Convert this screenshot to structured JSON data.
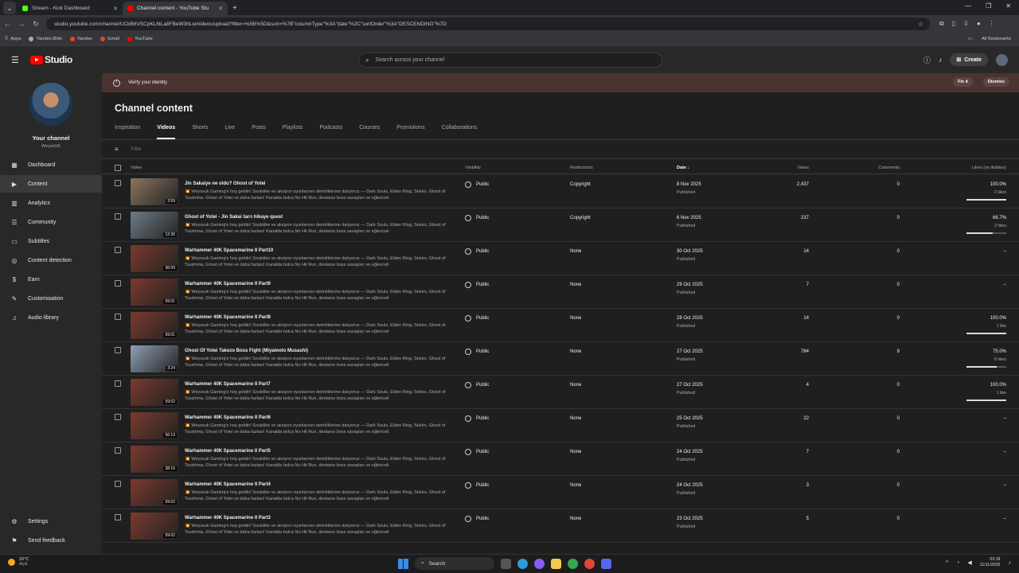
{
  "browser": {
    "tabs": [
      {
        "title": "Stream - Kick Dashboard",
        "fav_color": "#53fc18"
      },
      {
        "title": "Channel content - YouTube Stu",
        "fav_color": "#ff0000"
      }
    ],
    "url": "studio.youtube.com/channel/UCkB6VSCpKL6tLa8FBeW3hLw/videos/upload?filter=%5B%5D&sort=%7B\"columnType\"%3A\"date\"%2C\"sortOrder\"%3A\"DESCENDING\"%7D",
    "bookmarks": [
      "Apps",
      "Yandex.Bilet",
      "Yandex",
      "Gmail",
      "YouTube"
    ],
    "all_bookmarks": "All Bookmarks"
  },
  "header": {
    "logo_text": "Studio",
    "search_placeholder": "Search across your channel",
    "create_label": "Create"
  },
  "sidebar": {
    "channel_title": "Your channel",
    "channel_handle": "WeyssUK",
    "items": [
      {
        "label": "Dashboard",
        "icon": "dashboard-icon",
        "glyph": "▦"
      },
      {
        "label": "Content",
        "icon": "content-icon",
        "glyph": "▶"
      },
      {
        "label": "Analytics",
        "icon": "analytics-icon",
        "glyph": "▥"
      },
      {
        "label": "Community",
        "icon": "community-icon",
        "glyph": "☰"
      },
      {
        "label": "Subtitles",
        "icon": "subtitles-icon",
        "glyph": "▭"
      },
      {
        "label": "Content detection",
        "icon": "content-detection-icon",
        "glyph": "◎"
      },
      {
        "label": "Earn",
        "icon": "earn-icon",
        "glyph": "$"
      },
      {
        "label": "Customisation",
        "icon": "customisation-icon",
        "glyph": "✎"
      },
      {
        "label": "Audio library",
        "icon": "audio-library-icon",
        "glyph": "♫"
      }
    ],
    "settings": "Settings",
    "feedback": "Send feedback"
  },
  "banner": {
    "text": "Verify your identity",
    "fix": "Fix it",
    "dismiss": "Dismiss"
  },
  "page": {
    "title": "Channel content",
    "tabs": [
      "Inspiration",
      "Videos",
      "Shorts",
      "Live",
      "Posts",
      "Playlists",
      "Podcasts",
      "Courses",
      "Promotions",
      "Collaborations"
    ],
    "active_tab": "Videos",
    "filter_placeholder": "Filter"
  },
  "table": {
    "columns": {
      "video": "Video",
      "visibility": "Visibility",
      "restrictions": "Restrictions",
      "date": "Date ↓",
      "views": "Views",
      "comments": "Comments",
      "likes": "Likes (vs dislikes)"
    },
    "description": "💥 Weyssuk Gaming'e hoş geldin! Soulslike ve aksiyon oyunlarının derinliklerine dalıyoruz — Dark Souls, Elden Ring, Sekiro, Ghost of Tsushima, Ghost of Yotei ve daha fazlası! Kanalda bolca No Hit Run, destansı boss savaşları ve eğlenceli",
    "rows": [
      {
        "title": "Jin Sakaiye ne oldu? Ghost of Yotei",
        "duration": "2:59",
        "visibility": "Public",
        "restrictions": "Copyright",
        "date": "8 Nov 2025",
        "status": "Published",
        "views": "2,437",
        "comments": "0",
        "likes": "100.0%",
        "likes_count": "2 likes",
        "like_ratio": 1.0,
        "thumb": "#8a7560"
      },
      {
        "title": "Ghost of Yotei - Jin Sakai tarrı hikaye quest",
        "duration": "12:36",
        "visibility": "Public",
        "restrictions": "Copyright",
        "date": "6 Nov 2025",
        "status": "Published",
        "views": "237",
        "comments": "0",
        "likes": "66.7%",
        "likes_count": "2 likes",
        "like_ratio": 0.667,
        "thumb": "#6f7c86"
      },
      {
        "title": "Warhammer 40K Spacemarine II Part10",
        "duration": "36:09",
        "visibility": "Public",
        "restrictions": "None",
        "date": "30 Oct 2025",
        "status": "Published",
        "views": "14",
        "comments": "0",
        "likes": "–",
        "likes_count": "",
        "like_ratio": null,
        "thumb": "#7a3a2e"
      },
      {
        "title": "Warhammer 40K Spacemarine II Part9",
        "duration": "59:01",
        "visibility": "Public",
        "restrictions": "None",
        "date": "29 Oct 2025",
        "status": "Published",
        "views": "7",
        "comments": "0",
        "likes": "–",
        "likes_count": "",
        "like_ratio": null,
        "thumb": "#7a3a2e"
      },
      {
        "title": "Warhammer 40K Spacemarine II Part8",
        "duration": "59:01",
        "visibility": "Public",
        "restrictions": "None",
        "date": "28 Oct 2025",
        "status": "Published",
        "views": "14",
        "comments": "0",
        "likes": "100.0%",
        "likes_count": "1 like",
        "like_ratio": 1.0,
        "thumb": "#7a3a2e"
      },
      {
        "title": "Ghost Of Yotei Takezo Boss Fight (Miyamoto Musashi)",
        "duration": "3:24",
        "visibility": "Public",
        "restrictions": "None",
        "date": "27 Oct 2025",
        "status": "Published",
        "views": "784",
        "comments": "8",
        "likes": "75.0%",
        "likes_count": "6 likes",
        "like_ratio": 0.75,
        "thumb": "#8fa0b4"
      },
      {
        "title": "Warhammer 40K Spacemarine II Part7",
        "duration": "59:02",
        "visibility": "Public",
        "restrictions": "None",
        "date": "27 Oct 2025",
        "status": "Published",
        "views": "4",
        "comments": "0",
        "likes": "100.0%",
        "likes_count": "1 like",
        "like_ratio": 1.0,
        "thumb": "#7a3a2e"
      },
      {
        "title": "Warhammer 40K Spacemarine II Part6",
        "duration": "56:13",
        "visibility": "Public",
        "restrictions": "None",
        "date": "25 Oct 2025",
        "status": "Published",
        "views": "22",
        "comments": "0",
        "likes": "–",
        "likes_count": "",
        "like_ratio": null,
        "thumb": "#7a3a2e"
      },
      {
        "title": "Warhammer 40K Spacemarine II Part5",
        "duration": "38:16",
        "visibility": "Public",
        "restrictions": "None",
        "date": "24 Oct 2025",
        "status": "Published",
        "views": "7",
        "comments": "0",
        "likes": "–",
        "likes_count": "",
        "like_ratio": null,
        "thumb": "#7a3a2e"
      },
      {
        "title": "Warhammer 40K Spacemarine II Part4",
        "duration": "59:02",
        "visibility": "Public",
        "restrictions": "None",
        "date": "24 Oct 2025",
        "status": "Published",
        "views": "3",
        "comments": "0",
        "likes": "–",
        "likes_count": "",
        "like_ratio": null,
        "thumb": "#7a3a2e"
      },
      {
        "title": "Warhammer 40K Spacemarine II Part3",
        "duration": "59:02",
        "visibility": "Public",
        "restrictions": "None",
        "date": "23 Oct 2025",
        "status": "Published",
        "views": "5",
        "comments": "0",
        "likes": "–",
        "likes_count": "",
        "like_ratio": null,
        "thumb": "#7a3a2e"
      }
    ]
  },
  "taskbar": {
    "temp": "10°C",
    "weather": "Açık",
    "search": "Search",
    "time": "03:18",
    "date": "11/11/2025"
  }
}
